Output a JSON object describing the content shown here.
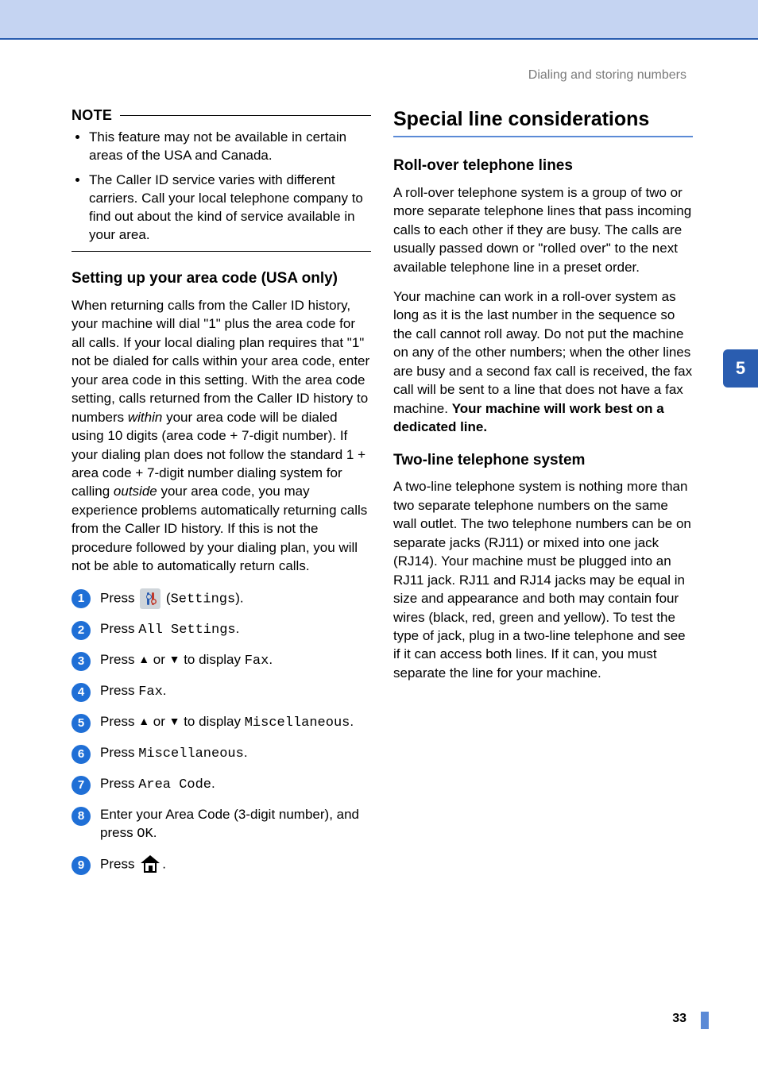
{
  "breadcrumb": "Dialing and storing numbers",
  "side_tab": "5",
  "page_number": "33",
  "left": {
    "note_label": "NOTE",
    "note_items": [
      "This feature may not be available in certain areas of the USA and Canada.",
      "The Caller ID service varies with different carriers. Call your local telephone company to find out about the kind of service available in your area."
    ],
    "setting_heading": "Setting up your area code (USA only)",
    "setting_body_parts": {
      "p1a": "When returning calls from the Caller ID history, your machine will dial \"1\" plus the area code for all calls. If your local dialing plan requires that \"1\" not be dialed for calls within your area code, enter your area code in this setting. With the area code setting, calls returned from the Caller ID history to numbers ",
      "p1b_italic": "within",
      "p1c": " your area code will be dialed using 10 digits (area code + 7-digit number). If your dialing plan does not follow the standard 1 + area code + 7-digit number dialing system for calling ",
      "p1d_italic": "outside",
      "p1e": " your area code, you may experience problems automatically returning calls from the Caller ID history. If this is not the procedure followed by your dialing plan, you will not be able to automatically return calls."
    },
    "steps": {
      "s1": {
        "a": "Press ",
        "b": " (",
        "c_mono": "Settings",
        "d": ")."
      },
      "s2": {
        "a": "Press ",
        "b_mono": "All Settings",
        "c": "."
      },
      "s3": {
        "a": "Press ",
        "up": "▲",
        "mid": " or ",
        "down": "▼",
        "b": " to display ",
        "c_mono": "Fax",
        "d": "."
      },
      "s4": {
        "a": "Press ",
        "b_mono": "Fax",
        "c": "."
      },
      "s5": {
        "a": "Press ",
        "up": "▲",
        "mid": " or ",
        "down": "▼",
        "b": " to display ",
        "c_mono": "Miscellaneous",
        "d": "."
      },
      "s6": {
        "a": "Press ",
        "b_mono": "Miscellaneous",
        "c": "."
      },
      "s7": {
        "a": "Press ",
        "b_mono": "Area Code",
        "c": "."
      },
      "s8": {
        "a": "Enter your Area Code (3-digit number), and press ",
        "b_mono": "OK",
        "c": "."
      },
      "s9": {
        "a": "Press ",
        "b": "."
      }
    }
  },
  "right": {
    "major_heading": "Special line considerations",
    "rollover_heading": "Roll-over telephone lines",
    "rollover_p1": "A roll-over telephone system is a group of two or more separate telephone lines that pass incoming calls to each other if they are busy. The calls are usually passed down or \"rolled over\" to the next available telephone line in a preset order.",
    "rollover_p2a": "Your machine can work in a roll-over system as long as it is the last number in the sequence so the call cannot roll away. Do not put the machine on any of the other numbers; when the other lines are busy and a second fax call is received, the fax call will be sent to a line that does not have a fax machine. ",
    "rollover_p2b_bold": "Your machine will work best on a dedicated line.",
    "twoline_heading": "Two-line telephone system",
    "twoline_p1": "A two-line telephone system is nothing more than two separate telephone numbers on the same wall outlet. The two telephone numbers can be on separate jacks (RJ11) or mixed into one jack (RJ14). Your machine must be plugged into an RJ11 jack. RJ11 and RJ14 jacks may be equal in size and appearance and both may contain four wires (black, red, green and yellow). To test the type of jack, plug in a two-line telephone and see if it can access both lines. If it can, you must separate the line for your machine."
  }
}
